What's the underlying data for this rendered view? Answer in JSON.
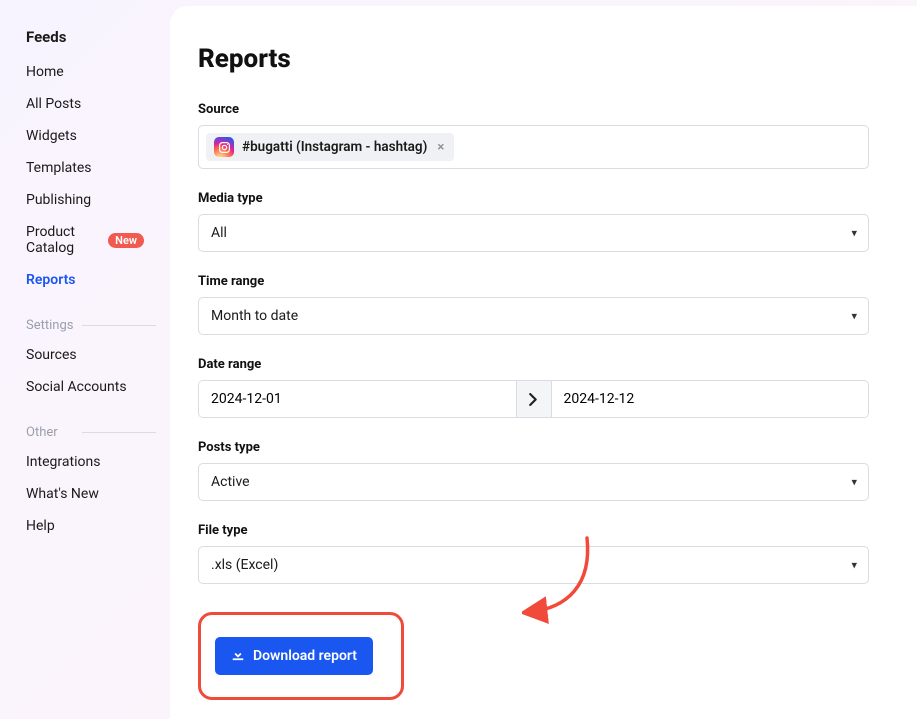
{
  "sidebar": {
    "heading": "Feeds",
    "items": [
      {
        "label": "Home"
      },
      {
        "label": "All Posts"
      },
      {
        "label": "Widgets"
      },
      {
        "label": "Templates"
      },
      {
        "label": "Publishing"
      },
      {
        "label": "Product Catalog",
        "badge": "New"
      },
      {
        "label": "Reports",
        "active": true
      }
    ],
    "sections": [
      {
        "label": "Settings",
        "items": [
          {
            "label": "Sources"
          },
          {
            "label": "Social Accounts"
          }
        ]
      },
      {
        "label": "Other",
        "items": [
          {
            "label": "Integrations"
          },
          {
            "label": "What's New"
          },
          {
            "label": "Help"
          }
        ]
      }
    ]
  },
  "page": {
    "title": "Reports",
    "source": {
      "label": "Source",
      "tag_text": "#bugatti (Instagram - hashtag)",
      "tag_icon": "instagram-icon"
    },
    "media_type": {
      "label": "Media type",
      "value": "All"
    },
    "time_range": {
      "label": "Time range",
      "value": "Month to date"
    },
    "date_range": {
      "label": "Date range",
      "start": "2024-12-01",
      "end": "2024-12-12"
    },
    "posts_type": {
      "label": "Posts type",
      "value": "Active"
    },
    "file_type": {
      "label": "File type",
      "value": ".xls (Excel)"
    },
    "download_label": "Download report"
  },
  "colors": {
    "accent": "#1a56f0",
    "annotation": "#f24a3a",
    "badge": "#f05a4f"
  }
}
